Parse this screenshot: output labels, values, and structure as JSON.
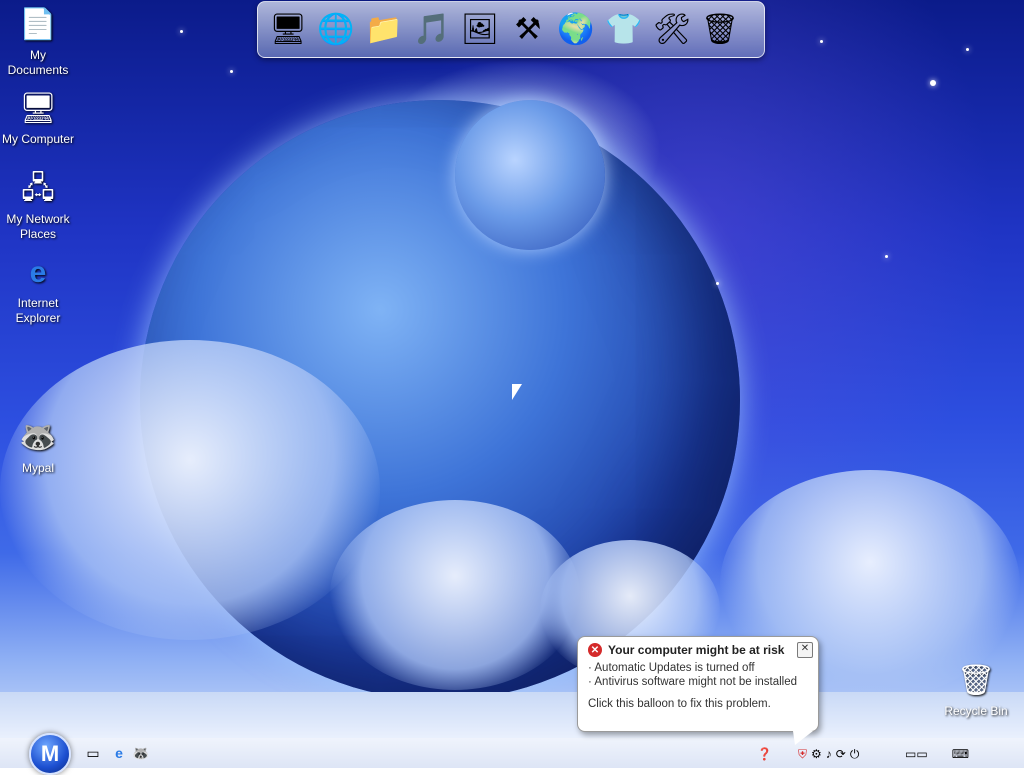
{
  "desktop": {
    "icons": [
      {
        "label": "My Documents",
        "icon": "documents-icon"
      },
      {
        "label": "My Computer",
        "icon": "computer-icon"
      },
      {
        "label": "My Network Places",
        "icon": "network-icon"
      },
      {
        "label": "Internet Explorer",
        "icon": "ie-icon"
      },
      {
        "label": "Mypal",
        "icon": "raccoon-icon"
      },
      {
        "label": "Recycle Bin",
        "icon": "recycle-bin-icon"
      }
    ]
  },
  "dock": {
    "items": [
      "computer-icon",
      "globe-documents-icon",
      "folder-icon",
      "music-folder-icon",
      "pictures-folder-icon",
      "tools-icon",
      "network-globe-icon",
      "tshirt-icon",
      "settings-tools-icon",
      "recycle-bin-icon"
    ]
  },
  "taskbar": {
    "start_label": "M",
    "quick_launch": [
      "show-desktop-icon",
      "ie-icon",
      "raccoon-icon"
    ],
    "tray": [
      "help-icon",
      "security-alert-icon",
      "network-icon",
      "sound-icon",
      "update-icon",
      "power-icon",
      "display-icon",
      "keyboard-icon"
    ]
  },
  "balloon": {
    "title": "Your computer might be at risk",
    "line1": "· Automatic Updates is turned off",
    "line2": "· Antivirus software might not be installed",
    "action": "Click this balloon to fix this problem.",
    "close": "✕"
  },
  "colors": {
    "alert_red": "#d42a2a",
    "balloon_bg": "#ffffff",
    "sky_top": "#0b1b8a",
    "sky_mid": "#2d4fe0"
  }
}
